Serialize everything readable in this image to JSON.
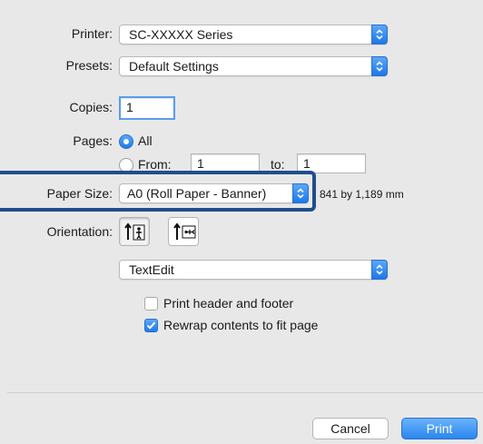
{
  "printer": {
    "label": "Printer:",
    "value": "SC-XXXXX Series"
  },
  "presets": {
    "label": "Presets:",
    "value": "Default Settings"
  },
  "copies": {
    "label": "Copies:",
    "value": "1"
  },
  "pages": {
    "label": "Pages:",
    "all_label": "All",
    "from_label": "From:",
    "from_value": "1",
    "to_label": "to:",
    "to_value": "1",
    "selected": "All"
  },
  "paper_size": {
    "label": "Paper Size:",
    "value": "A0 (Roll Paper - Banner)",
    "dimensions": "841 by 1,189 mm"
  },
  "orientation": {
    "label": "Orientation:",
    "selected": "portrait",
    "icons": [
      "portrait-orientation-icon",
      "landscape-orientation-icon"
    ]
  },
  "app_menu": {
    "value": "TextEdit"
  },
  "options": {
    "header_footer": {
      "label": "Print header and footer",
      "checked": false
    },
    "rewrap": {
      "label": "Rewrap contents to fit page",
      "checked": true
    }
  },
  "buttons": {
    "cancel": "Cancel",
    "print": "Print"
  },
  "colors": {
    "accent": "#2a86ee",
    "highlight_frame": "#1f4e8c",
    "panel_bg": "#e8e8e8"
  }
}
